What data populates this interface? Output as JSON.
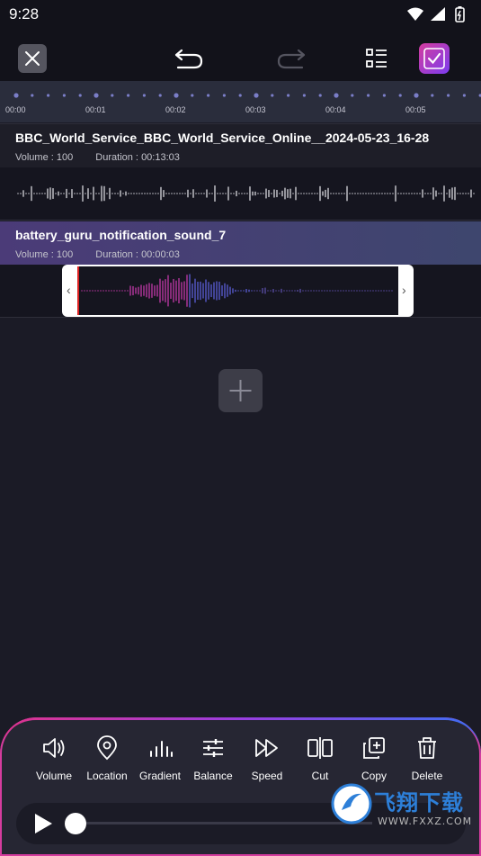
{
  "status_bar": {
    "time": "9:28"
  },
  "timeline": {
    "labels": [
      "00:00",
      "00:01",
      "00:02",
      "00:03",
      "00:04",
      "00:05"
    ]
  },
  "tracks": [
    {
      "title": "BBC_World_Service_BBC_World_Service_Online__2024-05-23_16-28",
      "volume_label": "Volume :",
      "volume_value": "100",
      "duration_label": "Duration :",
      "duration_value": "00:13:03"
    },
    {
      "title": "battery_guru_notification_sound_7",
      "volume_label": "Volume :",
      "volume_value": "100",
      "duration_label": "Duration :",
      "duration_value": "00:00:03",
      "selected": true
    }
  ],
  "tools": [
    {
      "label": "Volume",
      "icon": "speaker-icon"
    },
    {
      "label": "Location",
      "icon": "location-pin-icon"
    },
    {
      "label": "Gradient",
      "icon": "gradient-bars-icon"
    },
    {
      "label": "Balance",
      "icon": "sliders-icon"
    },
    {
      "label": "Speed",
      "icon": "fast-forward-icon"
    },
    {
      "label": "Cut",
      "icon": "cut-icon"
    },
    {
      "label": "Copy",
      "icon": "copy-icon"
    },
    {
      "label": "Delete",
      "icon": "trash-icon"
    }
  ],
  "player": {
    "progress": 0
  },
  "watermark": {
    "main": "飞翔下载",
    "sub": "WWW.FXXZ.COM"
  },
  "colors": {
    "accent_pink": "#d43c9e",
    "accent_purple": "#7b3cf0",
    "accent_blue": "#3d6ef2",
    "background": "#1b1b26"
  }
}
